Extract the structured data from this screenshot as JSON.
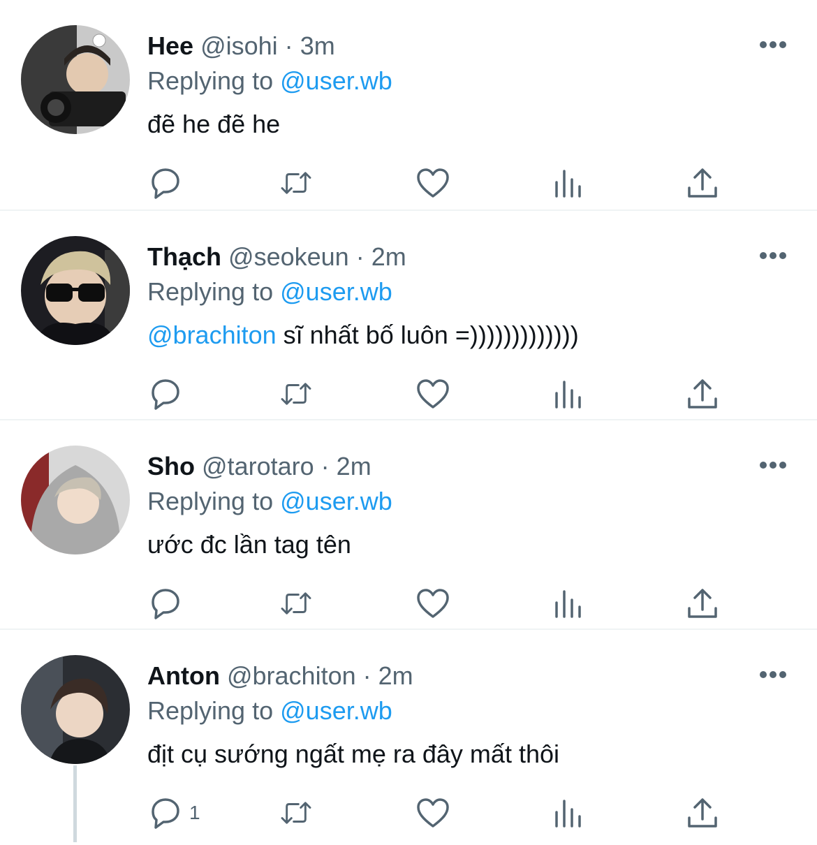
{
  "tweets": [
    {
      "name": "Hee",
      "handle": "@isohi",
      "dot": "·",
      "time": "3m",
      "replying_prefix": "Replying to",
      "replying_to": "@user.wb",
      "mention": "",
      "text": "đẽ he đẽ he",
      "reply_count": ""
    },
    {
      "name": "Thạch",
      "handle": "@seokeun",
      "dot": "·",
      "time": "2m",
      "replying_prefix": "Replying to",
      "replying_to": "@user.wb",
      "mention": "@brachiton",
      "text": " sĩ nhất bố luôn =)))))))))))))",
      "reply_count": ""
    },
    {
      "name": "Sho",
      "handle": "@tarotaro",
      "dot": "·",
      "time": "2m",
      "replying_prefix": "Replying to",
      "replying_to": "@user.wb",
      "mention": "",
      "text": "ước đc lần tag tên",
      "reply_count": ""
    },
    {
      "name": "Anton",
      "handle": "@brachiton",
      "dot": "·",
      "time": "2m",
      "replying_prefix": "Replying to",
      "replying_to": "@user.wb",
      "mention": "",
      "text": "địt cụ sướng ngất mẹ ra đây mất thôi",
      "reply_count": "1"
    }
  ],
  "colors": {
    "accent": "#1d9bf0",
    "secondary_text": "#536471",
    "divider": "#eff3f4"
  },
  "icons": [
    "reply-icon",
    "retweet-icon",
    "like-icon",
    "views-icon",
    "share-icon",
    "more-icon"
  ]
}
